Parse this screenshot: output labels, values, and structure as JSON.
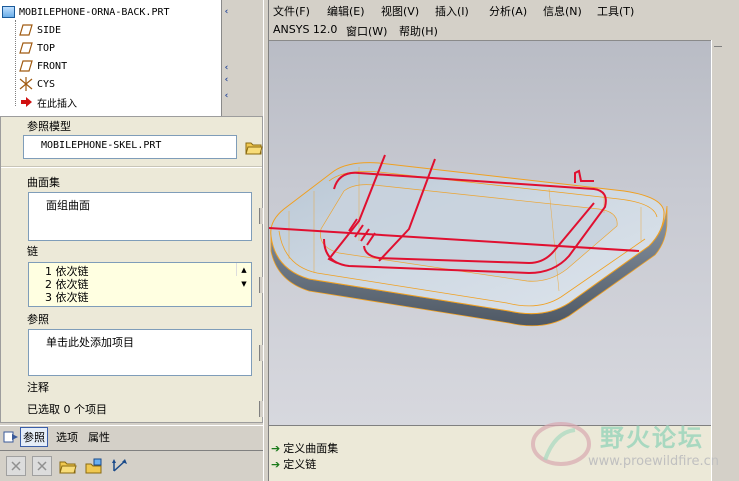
{
  "model_tree": {
    "root_label": "MOBILEPHONE-ORNA-BACK.PRT",
    "items": [
      {
        "label": "SIDE",
        "icon": "datum-plane-icon"
      },
      {
        "label": "TOP",
        "icon": "datum-plane-icon"
      },
      {
        "label": "FRONT",
        "icon": "datum-plane-icon"
      },
      {
        "label": "CYS",
        "icon": "coordinate-system-icon"
      },
      {
        "label": "在此插入",
        "icon": "insert-here-arrow-icon"
      }
    ]
  },
  "references_panel": {
    "ref_model_label": "参照模型",
    "ref_model_value": "MOBILEPHONE-SKEL.PRT",
    "surface_set_label": "曲面集",
    "surface_set_item": "面组曲面",
    "chain_label": "链",
    "chain_items": [
      "1  依次链",
      "2  依次链",
      "3  依次链"
    ],
    "reference_label": "参照",
    "reference_placeholder": "单击此处添加项目",
    "note_label": "注释",
    "selected_count_text": "已选取 0 个项目"
  },
  "tabs": [
    {
      "label": "参照",
      "active": true
    },
    {
      "label": "选项",
      "active": false
    },
    {
      "label": "属性",
      "active": false
    }
  ],
  "menu": {
    "row1": [
      "文件(F)",
      "编辑(E)",
      "视图(V)",
      "插入(I)",
      "分析(A)",
      "信息(N)",
      "工具(T)"
    ],
    "row2": [
      "ANSYS 12.0",
      "窗口(W)",
      "帮助(H)"
    ]
  },
  "messages": [
    "定义曲面集",
    "定义链"
  ],
  "watermark": {
    "title": "野火论坛",
    "url": "www.proewildfire.cn"
  },
  "colors": {
    "curve_red": "#e01030",
    "edge_orange": "#f0a020",
    "panel_bg": "#ece9d8",
    "chain_list_bg": "#ffffe1"
  }
}
